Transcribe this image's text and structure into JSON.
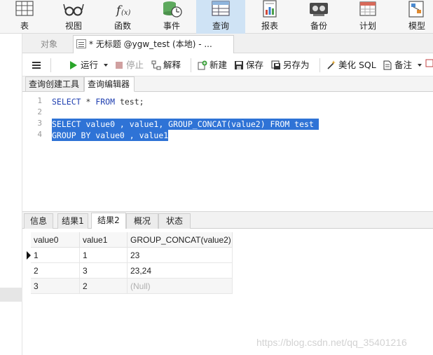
{
  "ribbon": {
    "items": [
      {
        "label": "表",
        "icon": "table-icon"
      },
      {
        "label": "视图",
        "icon": "view-glasses-icon"
      },
      {
        "label": "函数",
        "icon": "function-icon"
      },
      {
        "label": "事件",
        "icon": "event-clock-icon"
      },
      {
        "label": "查询",
        "icon": "query-icon",
        "active": true
      },
      {
        "label": "报表",
        "icon": "report-icon"
      },
      {
        "label": "备份",
        "icon": "backup-icon"
      },
      {
        "label": "计划",
        "icon": "schedule-icon"
      },
      {
        "label": "模型",
        "icon": "model-icon"
      }
    ]
  },
  "doc_tabs": {
    "objects_label": "对象",
    "query_tab_label": "* 无标题 @ygw_test (本地) - ..."
  },
  "toolbar": {
    "run_label": "运行",
    "stop_label": "停止",
    "explain_label": "解释",
    "new_label": "新建",
    "save_label": "保存",
    "save_as_label": "另存为",
    "beautify_label": "美化 SQL",
    "note_label": "备注"
  },
  "sub_tabs": {
    "builder_label": "查询创建工具",
    "editor_label": "查询编辑器"
  },
  "editor": {
    "lines": [
      {
        "num": "1",
        "keyword1": "SELECT",
        "rest": " * ",
        "keyword2": "FROM",
        "tail": " test;"
      },
      {
        "num": "2"
      },
      {
        "num": "3",
        "text": "SELECT value0 , value1, GROUP_CONCAT(value2) FROM test "
      },
      {
        "num": "4",
        "text": "GROUP BY value0 , value1"
      }
    ]
  },
  "result_tabs": [
    "信息",
    "结果1",
    "结果2",
    "概况",
    "状态"
  ],
  "result_tabs_active": "结果2",
  "grid": {
    "columns": [
      "value0",
      "value1",
      "GROUP_CONCAT(value2)"
    ],
    "rows": [
      [
        "1",
        "1",
        "23"
      ],
      [
        "2",
        "3",
        "23,24"
      ],
      [
        "3",
        "2",
        "(Null)"
      ]
    ]
  },
  "watermark": "https://blog.csdn.net/qq_35401216",
  "colors": {
    "selection": "#2f73d6",
    "keyword": "#1f3fb0",
    "ribbon_active": "#cfe3f5",
    "run_green": "#2aa52a",
    "stop_red": "#c04040"
  }
}
